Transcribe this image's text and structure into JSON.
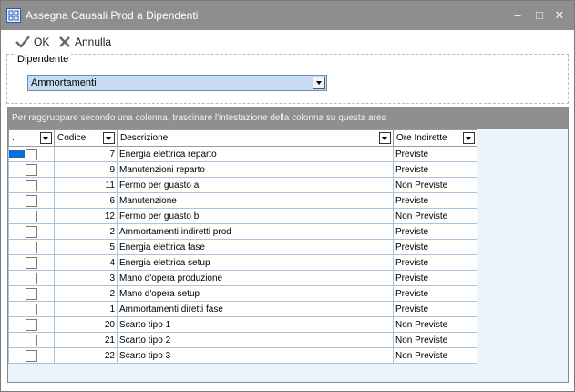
{
  "window": {
    "title": "Assegna Causali Prod a Dipendenti",
    "minimize_icon": "minimize-icon",
    "maximize_icon": "maximize-icon",
    "close_icon": "close-icon"
  },
  "toolbar": {
    "ok_label": "OK",
    "ok_icon": "checkmark-icon",
    "cancel_label": "Annulla",
    "cancel_icon": "cross-icon"
  },
  "dipendente": {
    "group_label": "Dipendente",
    "selected_value": "Ammortamenti"
  },
  "grid": {
    "group_panel_text": "Per raggruppare secondo una colonna, trascinare l'intestazione della colonna su questa area",
    "columns": [
      ".",
      "Codice",
      "Descrizione",
      "Ore Indirette"
    ],
    "rows": [
      {
        "codice": "7",
        "descrizione": "Energia elettrica reparto",
        "ore": "Previste"
      },
      {
        "codice": "9",
        "descrizione": "Manutenzioni reparto",
        "ore": "Previste"
      },
      {
        "codice": "11",
        "descrizione": "Fermo per guasto a",
        "ore": "Non Previste"
      },
      {
        "codice": "6",
        "descrizione": "Manutenzione",
        "ore": "Previste"
      },
      {
        "codice": "12",
        "descrizione": "Fermo per guasto b",
        "ore": "Non Previste"
      },
      {
        "codice": "2",
        "descrizione": "Ammortamenti indiretti prod",
        "ore": "Previste"
      },
      {
        "codice": "5",
        "descrizione": "Energia elettrica fase",
        "ore": "Previste"
      },
      {
        "codice": "4",
        "descrizione": "Energia elettrica setup",
        "ore": "Previste"
      },
      {
        "codice": "3",
        "descrizione": "Mano d'opera produzione",
        "ore": "Previste"
      },
      {
        "codice": "2",
        "descrizione": "Mano d'opera setup",
        "ore": "Previste"
      },
      {
        "codice": "1",
        "descrizione": "Ammortamenti diretti fase",
        "ore": "Previste"
      },
      {
        "codice": "20",
        "descrizione": "Scarto tipo 1",
        "ore": "Non Previste"
      },
      {
        "codice": "21",
        "descrizione": "Scarto tipo 2",
        "ore": "Non Previste"
      },
      {
        "codice": "22",
        "descrizione": "Scarto tipo 3",
        "ore": "Non Previste"
      }
    ],
    "checked": [
      false,
      false,
      false,
      false,
      false,
      false,
      false,
      false,
      false,
      false,
      false,
      false,
      false,
      false
    ]
  },
  "colors": {
    "titlebar": "#8e8e8e",
    "selected_row_marker": "#0a6fd6",
    "combo_background": "#c7dcf2",
    "grid_background": "#ecf4fb"
  }
}
